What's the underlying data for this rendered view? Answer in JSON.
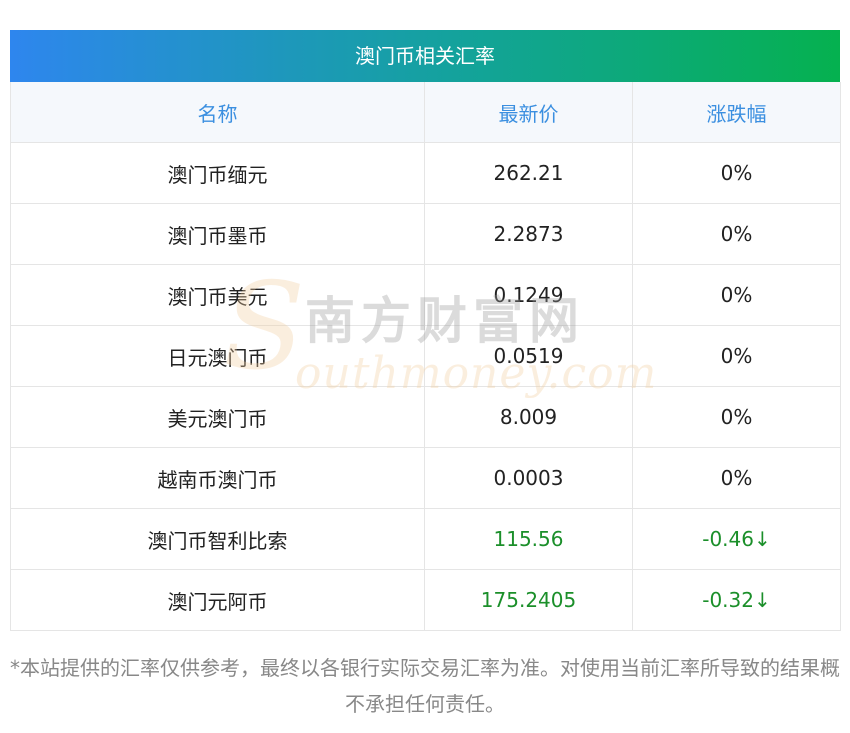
{
  "title": "澳门币相关汇率",
  "columns": [
    "名称",
    "最新价",
    "涨跌幅"
  ],
  "rows": [
    {
      "name": "澳门币缅元",
      "price": "262.21",
      "change": "0%",
      "trend": "flat"
    },
    {
      "name": "澳门币墨币",
      "price": "2.2873",
      "change": "0%",
      "trend": "flat"
    },
    {
      "name": "澳门币美元",
      "price": "0.1249",
      "change": "0%",
      "trend": "flat"
    },
    {
      "name": "日元澳门币",
      "price": "0.0519",
      "change": "0%",
      "trend": "flat"
    },
    {
      "name": "美元澳门币",
      "price": "8.009",
      "change": "0%",
      "trend": "flat"
    },
    {
      "name": "越南币澳门币",
      "price": "0.0003",
      "change": "0%",
      "trend": "flat"
    },
    {
      "name": "澳门币智利比索",
      "price": "115.56",
      "change": "-0.46↓",
      "trend": "down"
    },
    {
      "name": "澳门元阿币",
      "price": "175.2405",
      "change": "-0.32↓",
      "trend": "down"
    }
  ],
  "disclaimer": "*本站提供的汇率仅供参考，最终以各银行实际交易汇率为准。对使用当前汇率所导致的结果概不承担任何责任。",
  "watermark": {
    "letter": "S",
    "cn": "南方财富网",
    "en": "outhmoney.com"
  },
  "colors": {
    "header_gradient_start": "#2e86ee",
    "header_gradient_end": "#05b14f",
    "column_header_text": "#3b8fe0",
    "down_text": "#1b8f2a",
    "note_text": "#888888"
  }
}
